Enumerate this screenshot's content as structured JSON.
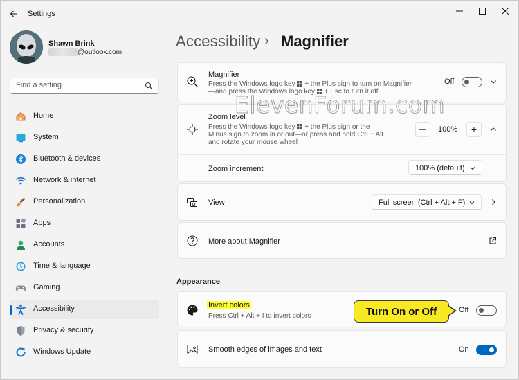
{
  "window": {
    "title": "Settings"
  },
  "profile": {
    "name": "Shawn Brink",
    "email_suffix": "@outlook.com"
  },
  "search": {
    "placeholder": "Find a setting"
  },
  "sidebar": {
    "items": [
      {
        "label": "Home",
        "icon": "home-icon"
      },
      {
        "label": "System",
        "icon": "system-icon"
      },
      {
        "label": "Bluetooth & devices",
        "icon": "bluetooth-icon"
      },
      {
        "label": "Network & internet",
        "icon": "wifi-icon"
      },
      {
        "label": "Personalization",
        "icon": "brush-icon"
      },
      {
        "label": "Apps",
        "icon": "apps-icon"
      },
      {
        "label": "Accounts",
        "icon": "accounts-icon"
      },
      {
        "label": "Time & language",
        "icon": "clock-icon"
      },
      {
        "label": "Gaming",
        "icon": "gamepad-icon"
      },
      {
        "label": "Accessibility",
        "icon": "accessibility-icon",
        "selected": true
      },
      {
        "label": "Privacy & security",
        "icon": "shield-icon"
      },
      {
        "label": "Windows Update",
        "icon": "update-icon"
      }
    ]
  },
  "breadcrumb": {
    "parent": "Accessibility",
    "separator": "›",
    "current": "Magnifier"
  },
  "magnifier": {
    "title": "Magnifier",
    "desc_a": "Press the Windows logo key",
    "desc_b": "+ the Plus sign to turn on Magnifier",
    "desc_c": "—and press the Windows logo key",
    "desc_d": "+ Esc to turn it off",
    "state": "Off"
  },
  "zoom_level": {
    "title": "Zoom level",
    "desc_a": "Press the Windows logo key",
    "desc_b": "+ the Plus sign or the",
    "desc_c": "Minus sign to zoom in or out—or press and hold Ctrl + Alt",
    "desc_d": "and rotate your mouse wheel",
    "value": "100%",
    "minus": "—",
    "plus": "+"
  },
  "zoom_increment": {
    "title": "Zoom increment",
    "value": "100% (default)"
  },
  "view": {
    "title": "View",
    "value": "Full screen (Ctrl + Alt + F)"
  },
  "more_about": {
    "title": "More about Magnifier"
  },
  "appearance": {
    "section": "Appearance"
  },
  "invert_colors": {
    "title": "Invert colors",
    "desc": "Press Ctrl + Alt + I to invert colors",
    "state": "Off"
  },
  "smooth_edges": {
    "title": "Smooth edges of images and text",
    "state": "On"
  },
  "callout": {
    "text": "Turn On or Off"
  },
  "watermark": {
    "text": "ElevenForum.com"
  },
  "colors": {
    "accent": "#0067c0",
    "highlight": "#ffff33",
    "callout": "#f7ea25"
  }
}
